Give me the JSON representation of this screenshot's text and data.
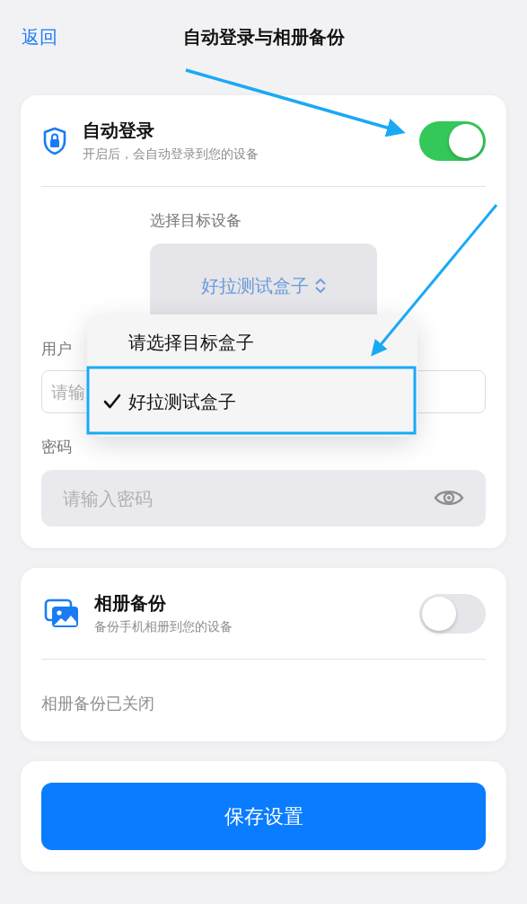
{
  "nav": {
    "back": "返回",
    "title": "自动登录与相册备份"
  },
  "auto_login": {
    "title": "自动登录",
    "subtitle": "开启后，会自动登录到您的设备",
    "on": true,
    "device_label": "选择目标设备",
    "device_value": "好拉测试盒子",
    "username_label": "用户",
    "username_placeholder": "请输",
    "password_label": "密码",
    "password_placeholder": "请输入密码"
  },
  "dropdown": [
    {
      "label": "请选择目标盒子",
      "selected": false
    },
    {
      "label": "好拉测试盒子",
      "selected": true
    }
  ],
  "album_backup": {
    "title": "相册备份",
    "subtitle": "备份手机相册到您的设备",
    "on": false,
    "status": "相册备份已关闭"
  },
  "save_button": "保存设置"
}
